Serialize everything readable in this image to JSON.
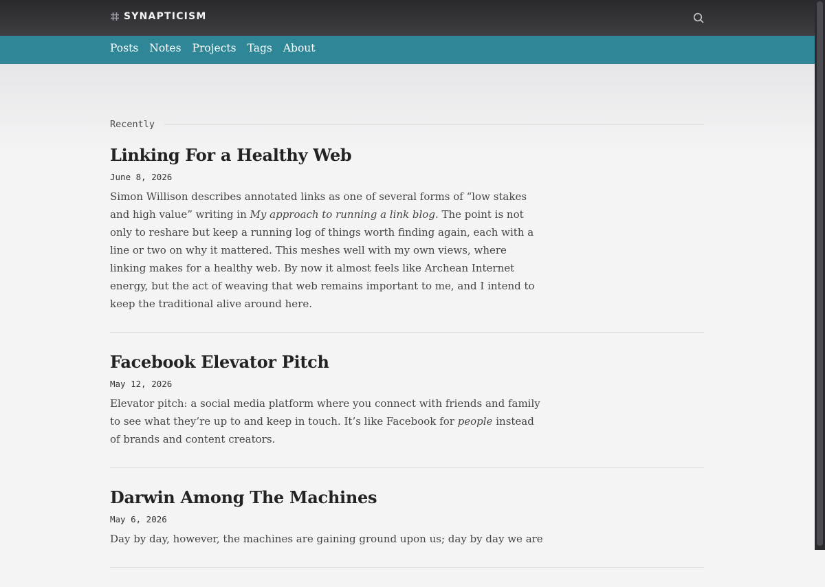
{
  "header": {
    "brand": "SYNAPTICISM",
    "brand_icon": "hash-icon",
    "search_icon": "search-icon",
    "colors": {
      "topbar": "#36363b",
      "navbar": "#2f8696"
    }
  },
  "nav": {
    "items": [
      "Posts",
      "Notes",
      "Projects",
      "Tags",
      "About"
    ]
  },
  "recent": {
    "label": "Recently",
    "posts": [
      {
        "title": "Linking For a Healthy Web",
        "date": "June 8, 2026",
        "excerpt_a": "Simon Willison describes annotated links as one of several forms of “low stakes and high value” writing in ",
        "excerpt_em": "My approach to running a link blog",
        "excerpt_b": ". The point is not only to reshare but keep a running log of things worth finding again, each with a line or two on why it mattered. This meshes well with my own views, where linking makes for a healthy web. By now it almost feels like Archean Internet energy, but the act of weaving that web remains important to me, and I intend to keep the traditional alive around here."
      },
      {
        "title": "Facebook Elevator Pitch",
        "date": "May 12, 2026",
        "excerpt_a": "Elevator pitch: a social media platform where you connect with friends and family to see what they’re up to and keep in touch. It’s like Facebook for ",
        "excerpt_em": "people",
        "excerpt_b": " instead of brands and content creators."
      },
      {
        "title": "Darwin Among The Machines",
        "date": "May 6, 2026",
        "excerpt_a": "Day by day, however, the machines are gaining ground upon us; day by day we are",
        "excerpt_em": "",
        "excerpt_b": ""
      }
    ]
  }
}
